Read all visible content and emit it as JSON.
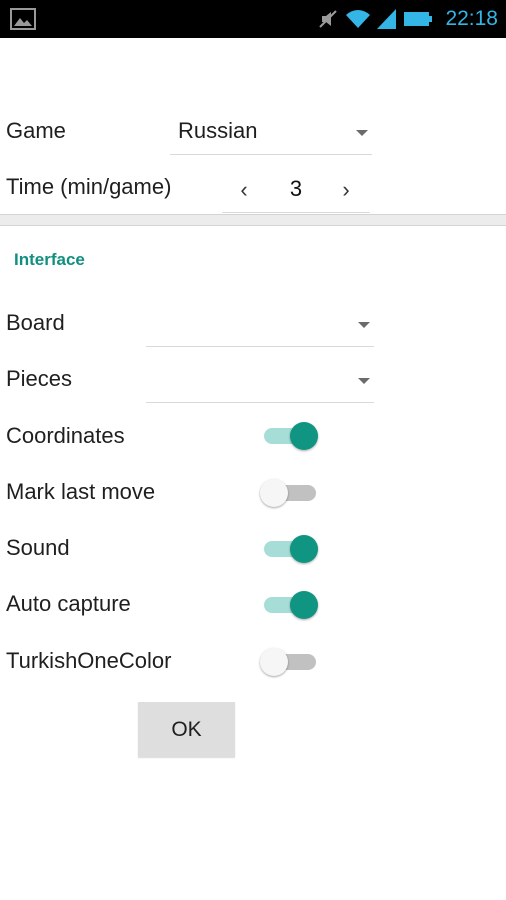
{
  "status_bar": {
    "time": "22:18",
    "icons": [
      "image-icon",
      "mute-icon",
      "wifi-icon",
      "signal-icon",
      "battery-icon"
    ]
  },
  "settings": {
    "game": {
      "label": "Game",
      "value": "Russian"
    },
    "time": {
      "label": "Time (min/game)",
      "value": "3",
      "prev_symbol": "‹",
      "next_symbol": "›"
    }
  },
  "interface": {
    "header": "Interface",
    "board": {
      "label": "Board",
      "value": ""
    },
    "pieces": {
      "label": "Pieces",
      "value": ""
    },
    "toggles": [
      {
        "label": "Coordinates",
        "on": true
      },
      {
        "label": "Mark last move",
        "on": false
      },
      {
        "label": "Sound",
        "on": true
      },
      {
        "label": "Auto capture",
        "on": true
      },
      {
        "label": "TurkishOneColor",
        "on": false
      }
    ]
  },
  "ok_button": {
    "label": "OK"
  },
  "colors": {
    "accent": "#0f9582",
    "accent_light": "#a6ded7",
    "status_text": "#33b5e5"
  }
}
